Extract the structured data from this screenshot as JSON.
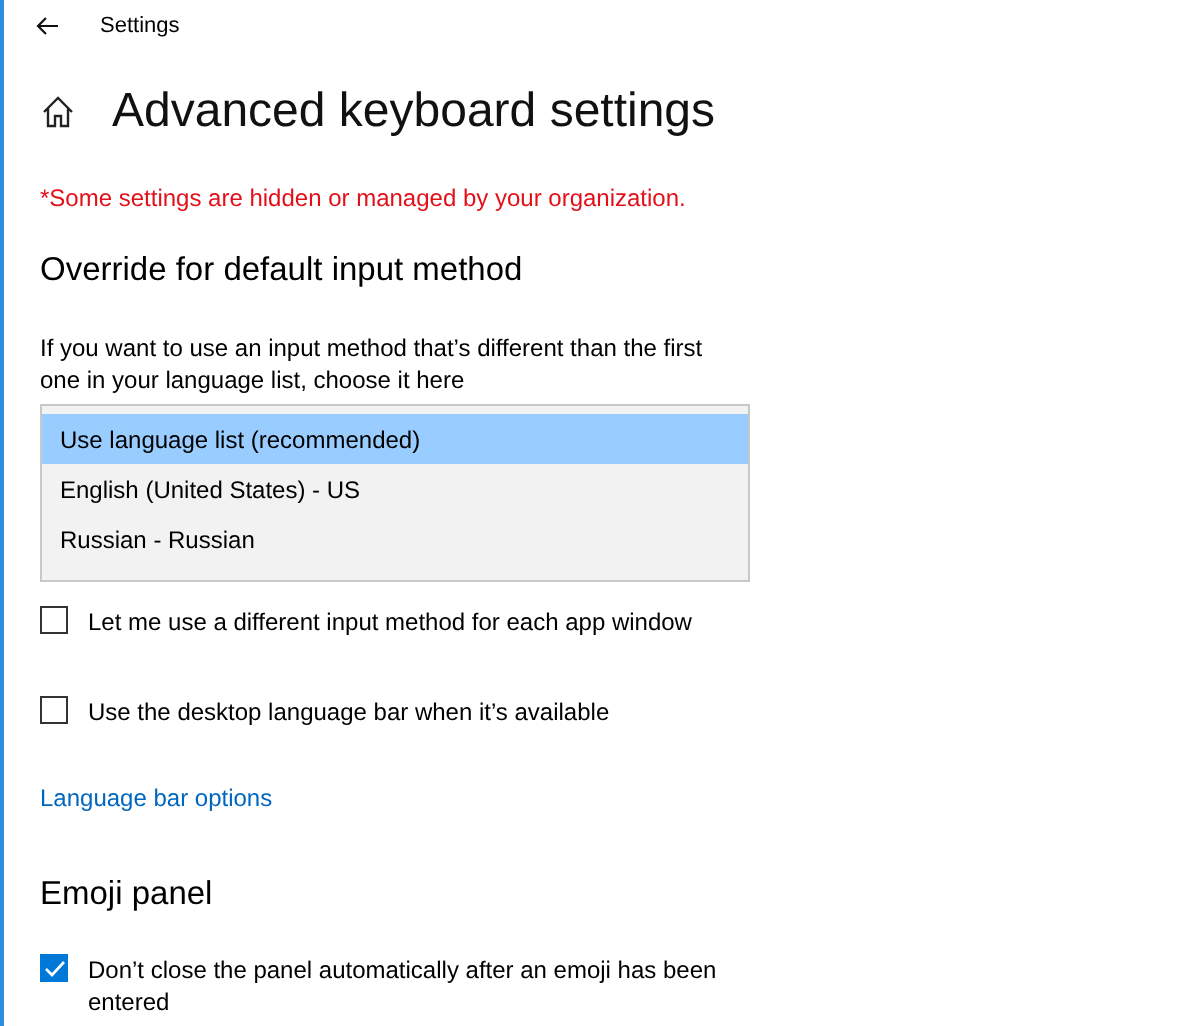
{
  "window": {
    "title": "Settings"
  },
  "page": {
    "title": "Advanced keyboard settings"
  },
  "warning": "*Some settings are hidden or managed by your organization.",
  "override": {
    "heading": "Override for default input method",
    "description": "If you want to use an input method that’s different than the first one in your language list, choose it here",
    "options": [
      {
        "label": "Use language list (recommended)",
        "selected": true
      },
      {
        "label": "English (United States) - US",
        "selected": false
      },
      {
        "label": "Russian - Russian",
        "selected": false
      }
    ]
  },
  "switching": [
    {
      "label": "Let me use a different input method for each app window",
      "checked": false
    },
    {
      "label": "Use the desktop language bar when it’s available",
      "checked": false
    }
  ],
  "link": "Language bar options",
  "emoji": {
    "heading": "Emoji panel",
    "options": [
      {
        "label": "Don’t close the panel automatically after an emoji has been entered",
        "checked": true
      }
    ]
  }
}
